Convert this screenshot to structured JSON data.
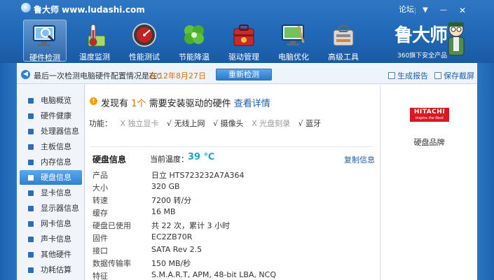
{
  "app": {
    "title": "鲁大师 www.ludashi.com",
    "forum": "论坛",
    "menu_glyph": "▼",
    "min_glyph": "—",
    "close_glyph": "✕"
  },
  "toolbar": [
    {
      "label": "硬件检测",
      "icon": "monitor-magnifier-icon",
      "active": true
    },
    {
      "label": "温度监测",
      "icon": "thermometer-icon",
      "active": false
    },
    {
      "label": "性能测试",
      "icon": "speedometer-icon",
      "active": false
    },
    {
      "label": "节能降温",
      "icon": "leaf-icon",
      "active": false
    },
    {
      "label": "驱动管理",
      "icon": "toolbox-icon",
      "active": false
    },
    {
      "label": "电脑优化",
      "icon": "monitor-clean-icon",
      "active": false
    },
    {
      "label": "高级工具",
      "icon": "toolkit-icon",
      "active": false
    }
  ],
  "brand": {
    "name": "鲁大师",
    "subtitle": "360旗下安全产品"
  },
  "infobar": {
    "text": "最后一次检测电脑硬件配置情况是在：",
    "date": "2012年8月27日",
    "recheck": "重新检测",
    "report": "生成报告",
    "screenshot": "保存截屏"
  },
  "sidebar": [
    {
      "label": "电脑概览",
      "active": false
    },
    {
      "label": "硬件健康",
      "active": false
    },
    {
      "label": "处理器信息",
      "active": false
    },
    {
      "label": "主板信息",
      "active": false
    },
    {
      "label": "内存信息",
      "active": false
    },
    {
      "label": "硬盘信息",
      "active": true
    },
    {
      "label": "显卡信息",
      "active": false
    },
    {
      "label": "显示器信息",
      "active": false
    },
    {
      "label": "网卡信息",
      "active": false
    },
    {
      "label": "声卡信息",
      "active": false
    },
    {
      "label": "其他硬件",
      "active": false
    },
    {
      "label": "功耗估算",
      "active": false
    }
  ],
  "alert": {
    "prefix": "发现有",
    "count": "1个",
    "suffix": "需要安装驱动的硬件",
    "detail": "查看详情"
  },
  "features": {
    "label": "功能：",
    "items": [
      {
        "mark": "X",
        "name": "独立显卡",
        "enabled": false
      },
      {
        "mark": "√",
        "name": "无线上网",
        "enabled": true
      },
      {
        "mark": "√",
        "name": "摄像头",
        "enabled": true
      },
      {
        "mark": "X",
        "name": "光盘刻录",
        "enabled": false
      },
      {
        "mark": "√",
        "name": "蓝牙",
        "enabled": true
      }
    ]
  },
  "disk": {
    "section_title": "硬盘信息",
    "temp_label": "当前温度：",
    "temp_value": "39 ℃",
    "copy": "复制信息",
    "rows": [
      {
        "key": "产品",
        "value": "日立 HTS723232A7A364"
      },
      {
        "key": "大小",
        "value": "320 GB"
      },
      {
        "key": "转速",
        "value": "7200 转/分"
      },
      {
        "key": "缓存",
        "value": "16 MB"
      },
      {
        "key": "硬盘已使用",
        "value": "共 22 次，累计 3 小时"
      },
      {
        "key": "固件",
        "value": "EC2ZB70R"
      },
      {
        "key": "接口",
        "value": "SATA Rev 2.5"
      },
      {
        "key": "数据传输率",
        "value": "150 MB/秒"
      },
      {
        "key": "特征",
        "value": "S.M.A.R.T,  APM,  48-bit LBA,  NCQ"
      }
    ]
  },
  "right_panel": {
    "logo_line1": "HITACHI",
    "logo_line2": "Inspire the Next",
    "caption": "硬盘品牌"
  },
  "colors": {
    "header": "#2068b6",
    "accent_orange": "#e06b00",
    "link_blue": "#1d5ea8",
    "temp_cyan": "#1aa5c9",
    "hitachi_red": "#d71920"
  }
}
